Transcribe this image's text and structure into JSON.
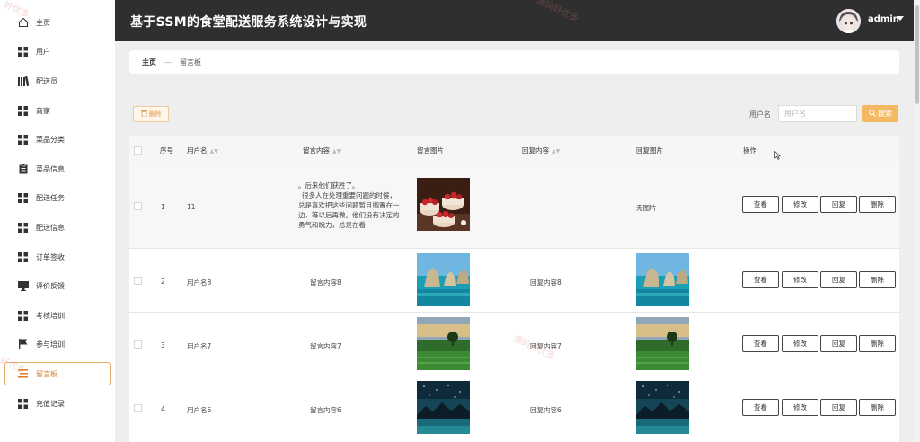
{
  "header": {
    "title": "基于SSM的食堂配送服务系统设计与实现",
    "user": "admin"
  },
  "sidebar": {
    "items": [
      {
        "label": "主页",
        "icon": "home-icon"
      },
      {
        "label": "用户",
        "icon": "grid-icon"
      },
      {
        "label": "配送员",
        "icon": "library-icon"
      },
      {
        "label": "商家",
        "icon": "grid-icon"
      },
      {
        "label": "菜品分类",
        "icon": "grid-icon"
      },
      {
        "label": "菜品信息",
        "icon": "clipboard-icon"
      },
      {
        "label": "配送任务",
        "icon": "grid-icon"
      },
      {
        "label": "配送信息",
        "icon": "grid-icon"
      },
      {
        "label": "订单签收",
        "icon": "grid-icon"
      },
      {
        "label": "评价反馈",
        "icon": "monitor-icon"
      },
      {
        "label": "考核培训",
        "icon": "grid-icon"
      },
      {
        "label": "参与培训",
        "icon": "flag-icon"
      },
      {
        "label": "留言板",
        "icon": "list-icon"
      },
      {
        "label": "充值记录",
        "icon": "grid-icon"
      }
    ],
    "active_index": 12
  },
  "breadcrumb": {
    "home": "主页",
    "separator": "—",
    "current": "留言板"
  },
  "toolbar": {
    "delete_label": "删除",
    "search_label": "用户名",
    "search_placeholder": "用户名",
    "search_button": "搜索"
  },
  "table": {
    "headers": {
      "index": "序号",
      "username": "用户名",
      "message": "留言内容",
      "message_image": "留言图片",
      "reply": "回复内容",
      "reply_image": "回复图片",
      "actions": "操作"
    },
    "rows": [
      {
        "index": "1",
        "username": "11",
        "message_lines": [
          "。后来他们获胜了。",
          "很多人在处理重要问题的时候，",
          "总是喜欢把这些问题暂且搁置在一",
          "边，等以后再做。他们没有决定的",
          "勇气和魄力，总是在看"
        ],
        "message_image": "cake",
        "reply": "",
        "reply_image": "",
        "reply_image_text": "无图片"
      },
      {
        "index": "2",
        "username": "用户名8",
        "message": "留言内容8",
        "message_image": "sea",
        "reply": "回复内容8",
        "reply_image": "sea",
        "reply_image_text": ""
      },
      {
        "index": "3",
        "username": "用户名7",
        "message": "留言内容7",
        "message_image": "field",
        "reply": "回复内容7",
        "reply_image": "field",
        "reply_image_text": ""
      },
      {
        "index": "4",
        "username": "用户名6",
        "message": "留言内容6",
        "message_image": "night",
        "reply": "回复内容6",
        "reply_image": "night",
        "reply_image_text": ""
      }
    ],
    "row_actions": [
      "查看",
      "修改",
      "回复",
      "删除"
    ]
  },
  "watermarks": [
    "好优多",
    "源码好优多",
    "源码好优多",
    "好优多"
  ],
  "colors": {
    "header_bg": "#2f2f2f",
    "accent": "#f5b961",
    "active_border": "#e0b06a"
  }
}
